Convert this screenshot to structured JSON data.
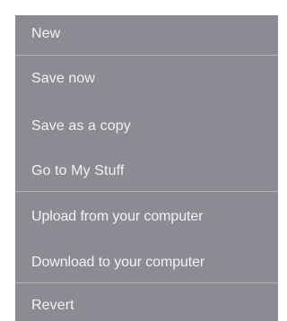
{
  "menu": {
    "items": [
      {
        "label": "New"
      },
      {
        "label": "Save now"
      },
      {
        "label": "Save as a copy"
      },
      {
        "label": "Go to My Stuff"
      },
      {
        "label": "Upload from your computer"
      },
      {
        "label": "Download to your computer"
      },
      {
        "label": "Revert"
      }
    ]
  },
  "colors": {
    "menu_background": "#8b8b93",
    "menu_text": "#f2f2f4",
    "divider": "#b4b4bb"
  }
}
